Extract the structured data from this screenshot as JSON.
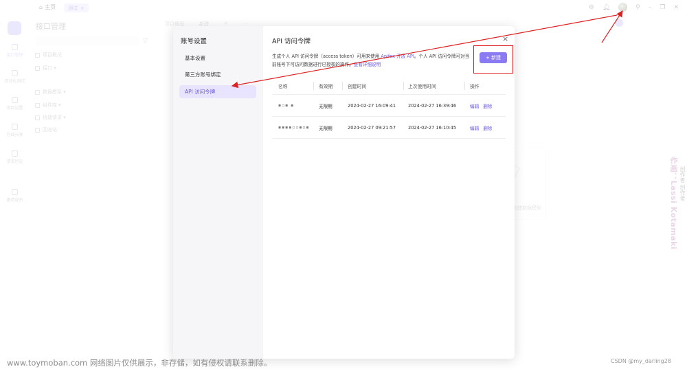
{
  "titlebar": {
    "home_label": "主页",
    "tab_label": "测试",
    "tab_close": "×",
    "icons": [
      "gear-icon",
      "bell-icon",
      "avatar",
      "pin-icon",
      "minimize-icon",
      "restore-icon",
      "close-icon"
    ]
  },
  "leftnav": {
    "items": [
      {
        "label": "接口管理"
      },
      {
        "label": "自动化测试"
      },
      {
        "label": "项目设置"
      },
      {
        "label": "在线分享"
      },
      {
        "label": "请求历史"
      },
      {
        "label": "邀请成员"
      }
    ]
  },
  "panel": {
    "title": "接口管理",
    "filter_icon": "▽",
    "add_label": "+",
    "tree": [
      "项目概况",
      "接口 ▾",
      "数据模型 ▾",
      "组件库 ▾",
      "快捷请求 ▾",
      "回收站"
    ]
  },
  "bg": {
    "tabs": [
      "项目概况",
      "新建",
      "+",
      "⋯"
    ],
    "card_label": "新建数据模型",
    "watermark": "作画：Lassi Kotamaki",
    "watermark2": "创作者 创作者"
  },
  "modal": {
    "side_title": "账号设置",
    "side_items": [
      "基本设置",
      "第三方账号绑定",
      "API 访问令牌"
    ],
    "title": "API 访问令牌",
    "close": "×",
    "desc_part1": "生成个人 API 访问令牌（access token）可用来使用 ",
    "desc_link1": "Apifox 开放 API",
    "desc_part2": "。个人 API 访问令牌可对当前账号下可访问数据进行已授权的操作。",
    "desc_link2": "查看详细说明",
    "new_button": "+ 新建",
    "table": {
      "headers": [
        "名称",
        "有效期",
        "创建时间",
        "上次使用时间",
        "操作"
      ],
      "rows": [
        {
          "name": "▪▫▪ ▪",
          "validity": "无限期",
          "created": "2024-02-27 16:09:41",
          "last_used": "2024-02-27 16:39:46",
          "edit": "编辑",
          "delete": "删除"
        },
        {
          "name": "▪▪▪▪▫▫▪▫▪",
          "validity": "无限期",
          "created": "2024-02-27 09:21:57",
          "last_used": "2024-02-27 16:10:45",
          "edit": "编辑",
          "delete": "删除"
        }
      ]
    }
  },
  "footer": {
    "left": "www.toymoban.com 网络图片仅供展示，非存储，如有侵权请联系删除。",
    "right": "CSDN @my_darling28"
  },
  "colors": {
    "accent": "#6b5de0",
    "button": "#8a7bf2",
    "annotation_red": "#e02020"
  }
}
